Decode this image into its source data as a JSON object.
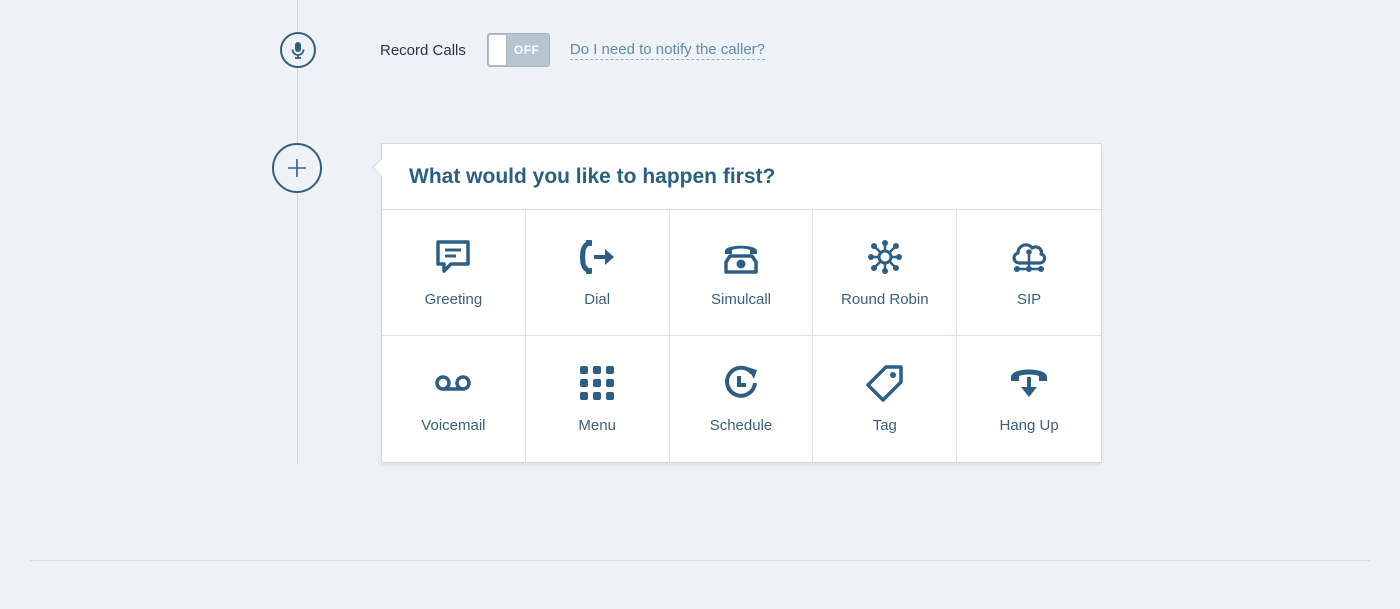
{
  "record": {
    "label": "Record Calls",
    "toggle_state": "OFF",
    "notify_link": "Do I need to notify the caller?"
  },
  "card": {
    "title": "What would you like to happen first?",
    "options": [
      {
        "label": "Greeting",
        "icon": "greeting-icon"
      },
      {
        "label": "Dial",
        "icon": "dial-icon"
      },
      {
        "label": "Simulcall",
        "icon": "simulcall-icon"
      },
      {
        "label": "Round Robin",
        "icon": "round-robin-icon"
      },
      {
        "label": "SIP",
        "icon": "sip-icon"
      },
      {
        "label": "Voicemail",
        "icon": "voicemail-icon"
      },
      {
        "label": "Menu",
        "icon": "menu-icon"
      },
      {
        "label": "Schedule",
        "icon": "schedule-icon"
      },
      {
        "label": "Tag",
        "icon": "tag-icon"
      },
      {
        "label": "Hang Up",
        "icon": "hang-up-icon"
      }
    ]
  },
  "colors": {
    "accent": "#2d5f84",
    "background": "#eef2f6",
    "link": "#5e8bb0",
    "toggle_off": "#b7c5d0"
  }
}
